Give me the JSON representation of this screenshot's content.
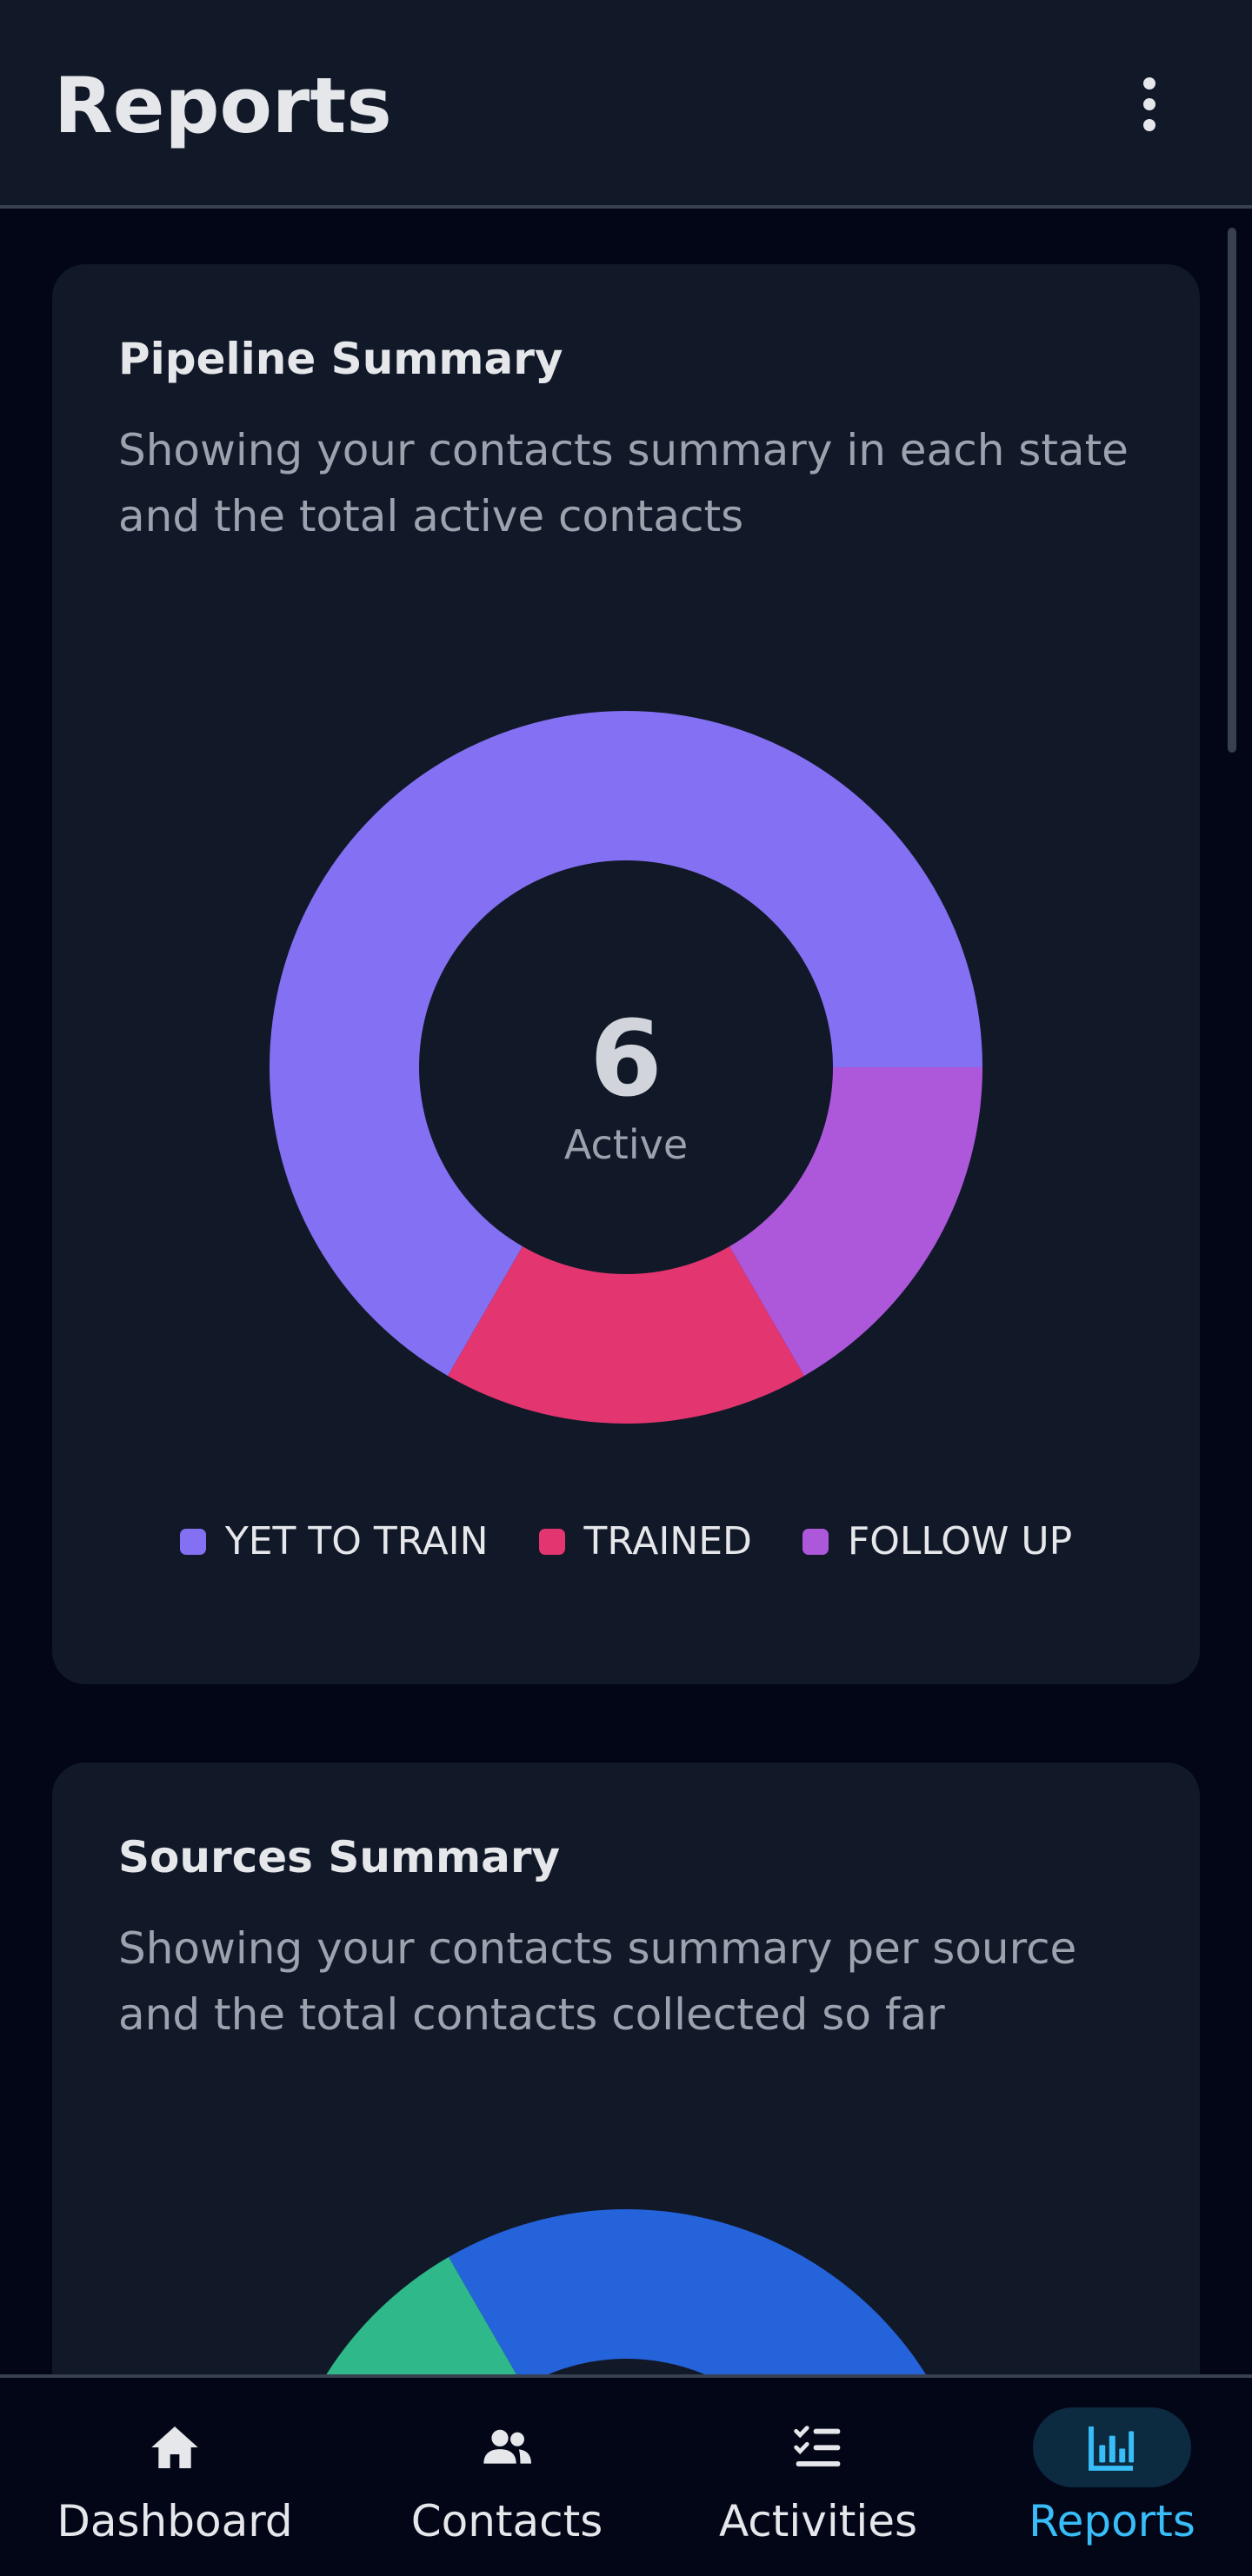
{
  "app_bar": {
    "title": "Reports",
    "menu_icon": "more-vertical-icon"
  },
  "pipeline": {
    "title": "Pipeline Summary",
    "description": "Showing your contacts summary in each state and the total active contacts",
    "center_value": "6",
    "center_label": "Active",
    "chart_data": {
      "type": "pie",
      "categories": [
        "YET TO TRAIN",
        "TRAINED",
        "FOLLOW UP"
      ],
      "values": [
        4,
        1,
        1
      ],
      "colors": [
        "#8470f3",
        "#e3356f",
        "#ad57da"
      ],
      "legend": "bottom"
    }
  },
  "sources": {
    "title": "Sources Summary",
    "description": "Showing your contacts summary per source and the total contacts collected so far",
    "colors": [
      "#2563db",
      "#2fb889"
    ]
  },
  "bottom_nav": {
    "items": [
      {
        "label": "Dashboard",
        "icon": "home-icon",
        "active": false
      },
      {
        "label": "Contacts",
        "icon": "people-icon",
        "active": false
      },
      {
        "label": "Activities",
        "icon": "checklist-icon",
        "active": false
      },
      {
        "label": "Reports",
        "icon": "bar-chart-icon",
        "active": true
      }
    ],
    "active_color": "#38bdf8"
  }
}
